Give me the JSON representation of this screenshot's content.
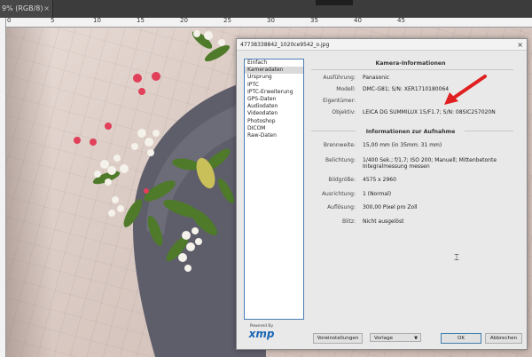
{
  "document": {
    "tab_label": "9% (RGB/8)",
    "ruler_numbers": [
      "0",
      "5",
      "10",
      "15",
      "20",
      "25",
      "30",
      "35",
      "40",
      "45"
    ]
  },
  "dialog": {
    "title": "47738338842_1020ce9542_o.jpg",
    "close_glyph": "×",
    "categories": [
      {
        "label": "Einfach",
        "selected": false
      },
      {
        "label": "Kameradaten",
        "selected": true
      },
      {
        "label": "Ursprung",
        "selected": false
      },
      {
        "label": "IPTC",
        "selected": false
      },
      {
        "label": "IPTC-Erweiterung",
        "selected": false
      },
      {
        "label": "GPS-Daten",
        "selected": false
      },
      {
        "label": "Audiodaten",
        "selected": false
      },
      {
        "label": "Videodaten",
        "selected": false
      },
      {
        "label": "Photoshop",
        "selected": false
      },
      {
        "label": "DICOM",
        "selected": false
      },
      {
        "label": "Raw-Daten",
        "selected": false
      }
    ],
    "camera_section": {
      "title": "Kamera-Informationen",
      "rows": [
        {
          "label": "Ausführung:",
          "value": "Panasonic"
        },
        {
          "label": "Modell:",
          "value": "DMC-G81;  S/N: XER1710180064"
        },
        {
          "label": "Eigentümer:",
          "value": ""
        },
        {
          "label": "Objektiv:",
          "value": "LEICA DG SUMMILUX 15/F1.7;  S/N: 08SIC257020N"
        }
      ]
    },
    "capture_section": {
      "title": "Informationen zur Aufnahme",
      "rows": [
        {
          "label": "Brennweite:",
          "value": "15,00 mm  (in 35mm: 31 mm)"
        },
        {
          "label": "Belichtung:",
          "value": "1/400 Sek.;  f/1,7;  ISO 200;  Manuell;  Mittenbetonte",
          "value2": "Integralmessung messen"
        },
        {
          "label": "Bildgröße:",
          "value": "4575 x 2960"
        },
        {
          "label": "Ausrichtung:",
          "value": "1 (Normal)"
        },
        {
          "label": "Auflösung:",
          "value": "300,00 Pixel pro Zoll"
        },
        {
          "label": "Blitz:",
          "value": "Nicht ausgelöst"
        }
      ]
    },
    "branding": {
      "powered_by": "Powered By",
      "logo": "xmp"
    },
    "buttons": {
      "presets": "Voreinstellungen",
      "template": "Vorlage",
      "ok": "OK",
      "cancel": "Abbrechen"
    },
    "annotation_color": "#e02020"
  }
}
